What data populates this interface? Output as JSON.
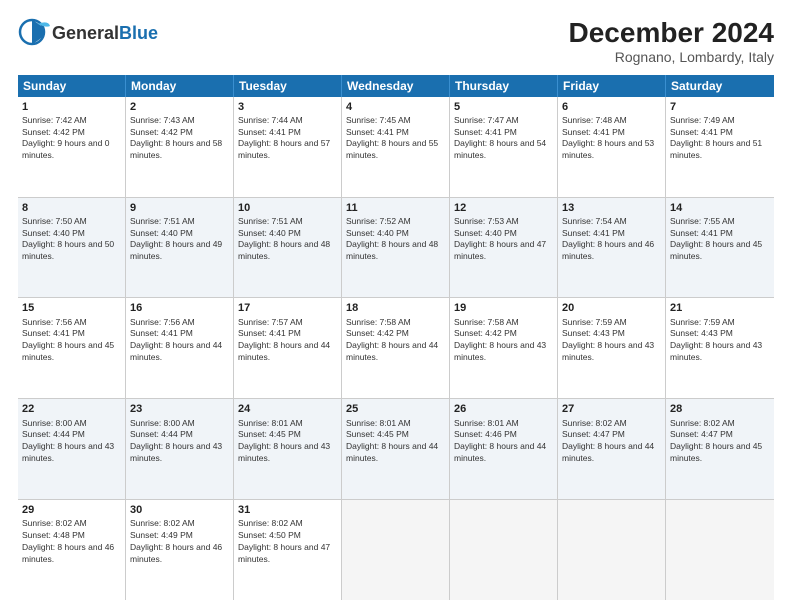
{
  "header": {
    "logo_general": "General",
    "logo_blue": "Blue",
    "title": "December 2024",
    "subtitle": "Rognano, Lombardy, Italy"
  },
  "days": [
    "Sunday",
    "Monday",
    "Tuesday",
    "Wednesday",
    "Thursday",
    "Friday",
    "Saturday"
  ],
  "weeks": [
    [
      {
        "day": "1",
        "rise": "7:42 AM",
        "set": "4:42 PM",
        "daylight": "9 hours and 0 minutes."
      },
      {
        "day": "2",
        "rise": "7:43 AM",
        "set": "4:42 PM",
        "daylight": "8 hours and 58 minutes."
      },
      {
        "day": "3",
        "rise": "7:44 AM",
        "set": "4:41 PM",
        "daylight": "8 hours and 57 minutes."
      },
      {
        "day": "4",
        "rise": "7:45 AM",
        "set": "4:41 PM",
        "daylight": "8 hours and 55 minutes."
      },
      {
        "day": "5",
        "rise": "7:47 AM",
        "set": "4:41 PM",
        "daylight": "8 hours and 54 minutes."
      },
      {
        "day": "6",
        "rise": "7:48 AM",
        "set": "4:41 PM",
        "daylight": "8 hours and 53 minutes."
      },
      {
        "day": "7",
        "rise": "7:49 AM",
        "set": "4:41 PM",
        "daylight": "8 hours and 51 minutes."
      }
    ],
    [
      {
        "day": "8",
        "rise": "7:50 AM",
        "set": "4:40 PM",
        "daylight": "8 hours and 50 minutes."
      },
      {
        "day": "9",
        "rise": "7:51 AM",
        "set": "4:40 PM",
        "daylight": "8 hours and 49 minutes."
      },
      {
        "day": "10",
        "rise": "7:51 AM",
        "set": "4:40 PM",
        "daylight": "8 hours and 48 minutes."
      },
      {
        "day": "11",
        "rise": "7:52 AM",
        "set": "4:40 PM",
        "daylight": "8 hours and 48 minutes."
      },
      {
        "day": "12",
        "rise": "7:53 AM",
        "set": "4:40 PM",
        "daylight": "8 hours and 47 minutes."
      },
      {
        "day": "13",
        "rise": "7:54 AM",
        "set": "4:41 PM",
        "daylight": "8 hours and 46 minutes."
      },
      {
        "day": "14",
        "rise": "7:55 AM",
        "set": "4:41 PM",
        "daylight": "8 hours and 45 minutes."
      }
    ],
    [
      {
        "day": "15",
        "rise": "7:56 AM",
        "set": "4:41 PM",
        "daylight": "8 hours and 45 minutes."
      },
      {
        "day": "16",
        "rise": "7:56 AM",
        "set": "4:41 PM",
        "daylight": "8 hours and 44 minutes."
      },
      {
        "day": "17",
        "rise": "7:57 AM",
        "set": "4:41 PM",
        "daylight": "8 hours and 44 minutes."
      },
      {
        "day": "18",
        "rise": "7:58 AM",
        "set": "4:42 PM",
        "daylight": "8 hours and 44 minutes."
      },
      {
        "day": "19",
        "rise": "7:58 AM",
        "set": "4:42 PM",
        "daylight": "8 hours and 43 minutes."
      },
      {
        "day": "20",
        "rise": "7:59 AM",
        "set": "4:43 PM",
        "daylight": "8 hours and 43 minutes."
      },
      {
        "day": "21",
        "rise": "7:59 AM",
        "set": "4:43 PM",
        "daylight": "8 hours and 43 minutes."
      }
    ],
    [
      {
        "day": "22",
        "rise": "8:00 AM",
        "set": "4:44 PM",
        "daylight": "8 hours and 43 minutes."
      },
      {
        "day": "23",
        "rise": "8:00 AM",
        "set": "4:44 PM",
        "daylight": "8 hours and 43 minutes."
      },
      {
        "day": "24",
        "rise": "8:01 AM",
        "set": "4:45 PM",
        "daylight": "8 hours and 43 minutes."
      },
      {
        "day": "25",
        "rise": "8:01 AM",
        "set": "4:45 PM",
        "daylight": "8 hours and 44 minutes."
      },
      {
        "day": "26",
        "rise": "8:01 AM",
        "set": "4:46 PM",
        "daylight": "8 hours and 44 minutes."
      },
      {
        "day": "27",
        "rise": "8:02 AM",
        "set": "4:47 PM",
        "daylight": "8 hours and 44 minutes."
      },
      {
        "day": "28",
        "rise": "8:02 AM",
        "set": "4:47 PM",
        "daylight": "8 hours and 45 minutes."
      }
    ],
    [
      {
        "day": "29",
        "rise": "8:02 AM",
        "set": "4:48 PM",
        "daylight": "8 hours and 46 minutes."
      },
      {
        "day": "30",
        "rise": "8:02 AM",
        "set": "4:49 PM",
        "daylight": "8 hours and 46 minutes."
      },
      {
        "day": "31",
        "rise": "8:02 AM",
        "set": "4:50 PM",
        "daylight": "8 hours and 47 minutes."
      },
      null,
      null,
      null,
      null
    ]
  ],
  "labels": {
    "sunrise": "Sunrise:",
    "sunset": "Sunset:",
    "daylight": "Daylight:"
  }
}
